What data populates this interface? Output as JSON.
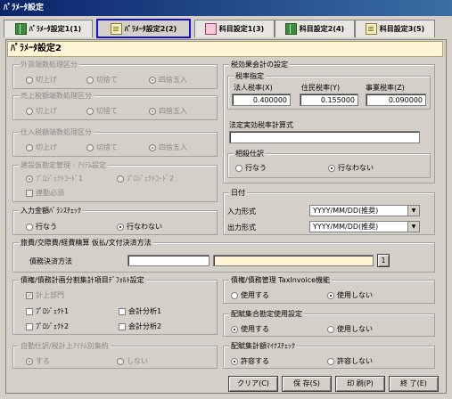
{
  "window": {
    "title": "ﾊﾟﾗﾒｰﾀ設定"
  },
  "tabs": [
    {
      "label": "ﾊﾟﾗﾒｰﾀ設定1(1)",
      "icon": "book-icon"
    },
    {
      "label": "ﾊﾟﾗﾒｰﾀ設定2(2)",
      "icon": "note-icon"
    },
    {
      "label": "科目設定1(3)",
      "icon": "card-icon"
    },
    {
      "label": "科目設定2(4)",
      "icon": "book-icon"
    },
    {
      "label": "科目設定3(5)",
      "icon": "note-icon"
    }
  ],
  "panel": {
    "title": "ﾊﾟﾗﾒｰﾀ設定2"
  },
  "fraction_out": {
    "label": "外貨端数処理区分",
    "options": [
      "切上げ",
      "切捨て",
      "四捨五入"
    ],
    "selected": 2
  },
  "fraction_sales": {
    "label": "売上税額端数処理区分",
    "options": [
      "切上げ",
      "切捨て",
      "四捨五入"
    ],
    "selected": 2
  },
  "fraction_purchase": {
    "label": "仕入税額端数処理区分",
    "options": [
      "切上げ",
      "切捨て",
      "四捨五入"
    ],
    "selected": 2
  },
  "construction": {
    "label": "建設仮勘定管理 - ｱｲﾃﾑ設定",
    "opt1": "ﾌﾟﾛｼﾞｪｸﾄｺｰﾄﾞ1",
    "opt2": "ﾌﾟﾛｼﾞｪｸﾄｺｰﾄﾞ2",
    "checkbox": "連動必須"
  },
  "input_check": {
    "label": "入力金額ﾊﾞﾗﾝｽﾁｪｯｸ",
    "options": [
      "行なう",
      "行なわない"
    ],
    "selected": 1
  },
  "tax_effect": {
    "label": "税効果会計の設定",
    "rate_label": "税率指定",
    "headers": [
      "法人税率(X)",
      "住民税率(Y)",
      "事業税率(Z)"
    ],
    "values": [
      "0.400000",
      "0.155000",
      "0.090000"
    ],
    "formula_label": "法定実効税率計算式",
    "offset_label": "相殺仕訳",
    "offset_options": [
      "行なう",
      "行なわない"
    ],
    "offset_selected": 1
  },
  "date": {
    "label": "日付",
    "input_label": "入力形式",
    "input_value": "YYYY/MM/DD(推奨)",
    "output_label": "出力形式",
    "output_value": "YYYY/MM/DD(推奨)"
  },
  "travel": {
    "label": "旅費/交際費/経費精算 仮払/文付決済方法",
    "debt_label": "債務決済方法",
    "button": "1"
  },
  "debt_alloc": {
    "label": "債権/債務計画分割集計項目ﾃﾞﾌｫﾙﾄ設定",
    "checks": [
      "計上部門",
      "ﾌﾟﾛｼﾞｪｸﾄ1",
      "会計分析1",
      "ﾌﾟﾛｼﾞｪｸﾄ2",
      "会計分析2"
    ]
  },
  "auto_journal": {
    "label": "自動仕訳/税計上ｱｲﾃﾑ別集約",
    "options": [
      "する",
      "しない"
    ],
    "selected": 0
  },
  "tax_invoice": {
    "label": "債権/債務管理 TaxInvoice機能",
    "options": [
      "使用する",
      "使用しない"
    ],
    "selected": 1
  },
  "alloc_total": {
    "label": "配賦集合勘定使用設定",
    "options": [
      "使用する",
      "使用しない"
    ],
    "selected": 0
  },
  "alloc_check": {
    "label": "配賦集計額ﾏｲﾅｽﾁｪｯｸ",
    "options": [
      "許容する",
      "許容しない"
    ],
    "selected": 0
  },
  "buttons": {
    "clear": "クリア(C)",
    "save": "保 存(S)",
    "print": "印 刷(P)",
    "exit": "終 了(E)"
  }
}
